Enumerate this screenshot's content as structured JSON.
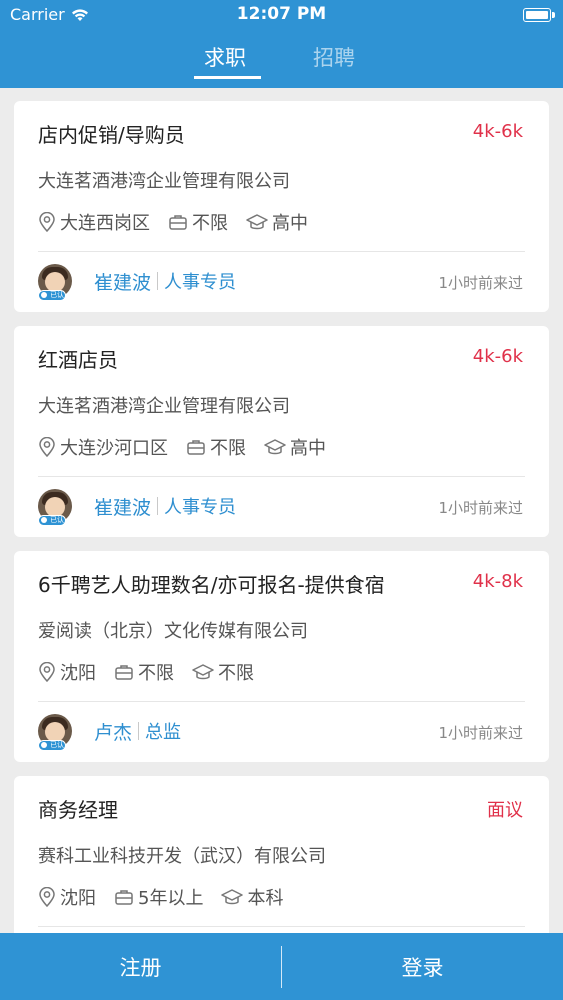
{
  "status_bar": {
    "carrier": "Carrier",
    "time": "12:07 PM"
  },
  "tabs": [
    {
      "label": "求职",
      "active": true
    },
    {
      "label": "招聘",
      "active": false
    }
  ],
  "jobs": [
    {
      "title": "店内促销/导购员",
      "salary": "4k-6k",
      "company": "大连茗酒港湾企业管理有限公司",
      "location": "大连西岗区",
      "experience": "不限",
      "education": "高中",
      "recruiter_name": "崔建波",
      "recruiter_role": "人事专员",
      "verified_badge": "已认证",
      "last_seen": "1小时前来过"
    },
    {
      "title": "红酒店员",
      "salary": "4k-6k",
      "company": "大连茗酒港湾企业管理有限公司",
      "location": "大连沙河口区",
      "experience": "不限",
      "education": "高中",
      "recruiter_name": "崔建波",
      "recruiter_role": "人事专员",
      "verified_badge": "已认证",
      "last_seen": "1小时前来过"
    },
    {
      "title": "6千聘艺人助理数名/亦可报名-提供食宿",
      "salary": "4k-8k",
      "company": "爱阅读（北京）文化传媒有限公司",
      "location": "沈阳",
      "experience": "不限",
      "education": "不限",
      "recruiter_name": "卢杰",
      "recruiter_role": "总监",
      "verified_badge": "已认证",
      "last_seen": "1小时前来过"
    },
    {
      "title": "商务经理",
      "salary": "面议",
      "company": "赛科工业科技开发（武汉）有限公司",
      "location": "沈阳",
      "experience": "5年以上",
      "education": "本科"
    }
  ],
  "bottom_bar": {
    "register_label": "注册",
    "login_label": "登录"
  },
  "colors": {
    "brand_blue": "#2f93d4",
    "salary_red": "#e0314a",
    "link_blue": "#2f8fd0"
  }
}
